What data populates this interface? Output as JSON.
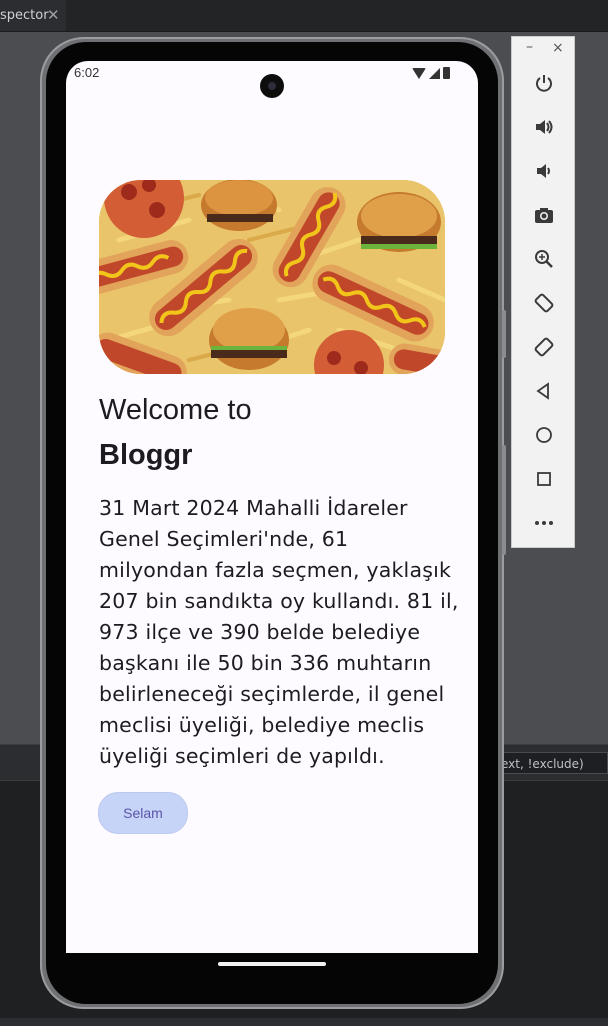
{
  "ide": {
    "tab_label": "spector",
    "tab_close": "✕",
    "filter_text": "ext, !exclude)"
  },
  "device": {
    "status_time": "6:02"
  },
  "app": {
    "welcome_line": "Welcome to",
    "app_name": "Bloggr",
    "body_text": "31 Mart 2024 Mahalli İdareler Genel Seçimleri'nde, 61 milyondan fazla seçmen, yaklaşık 207 bin sandıkta oy kullandı. 81 il, 973 ilçe ve 390 belde belediye başkanı ile 50 bin 336 muhtarın belirleneceği seçimlerde, il genel meclisi üyeliği, belediye meclis üyeliği seçimleri de yapıldı.",
    "button_label": "Selam",
    "hero_image": "fast-food-collage"
  },
  "emulator_toolbar": {
    "minimize": "–",
    "close": "×",
    "buttons": [
      {
        "name": "power-icon"
      },
      {
        "name": "volume-up-icon"
      },
      {
        "name": "volume-down-icon"
      },
      {
        "name": "camera-icon"
      },
      {
        "name": "zoom-icon"
      },
      {
        "name": "rotate-left-icon"
      },
      {
        "name": "rotate-right-icon"
      },
      {
        "name": "back-icon"
      },
      {
        "name": "home-icon"
      },
      {
        "name": "overview-icon"
      },
      {
        "name": "more-icon"
      }
    ]
  },
  "colors": {
    "accent": "#c6d4f7",
    "button_text": "#5b55a8",
    "screen_bg": "#fdfbff"
  }
}
